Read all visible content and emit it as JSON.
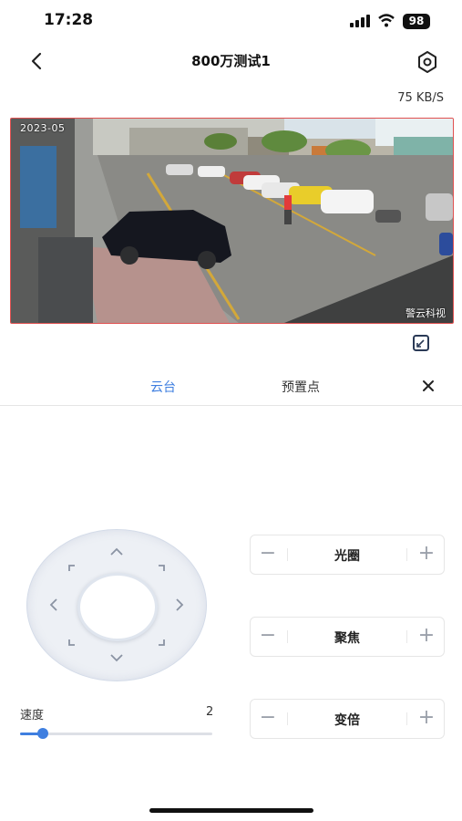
{
  "status_bar": {
    "time": "17:28",
    "battery": "98"
  },
  "header": {
    "title": "800万测试1"
  },
  "stream": {
    "bitrate": "75 KB/S",
    "osd_date": "2023-05",
    "osd_mark": "警云科视"
  },
  "tabs": [
    {
      "label": "云台",
      "active": true
    },
    {
      "label": "预置点",
      "active": false
    }
  ],
  "controls": [
    {
      "label": "光圈",
      "minus": "−",
      "plus": "+"
    },
    {
      "label": "聚焦",
      "minus": "−",
      "plus": "+"
    },
    {
      "label": "变倍",
      "minus": "−",
      "plus": "+"
    }
  ],
  "speed": {
    "label": "速度",
    "value": "2",
    "level_fraction": 0.12
  },
  "colors": {
    "accent": "#3f7fe0",
    "video_border": "#e05050"
  },
  "icons": [
    "back-arrow-icon",
    "eye-settings-icon",
    "fullscreen-icon",
    "close-icon",
    "signal-icon",
    "wifi-icon"
  ]
}
